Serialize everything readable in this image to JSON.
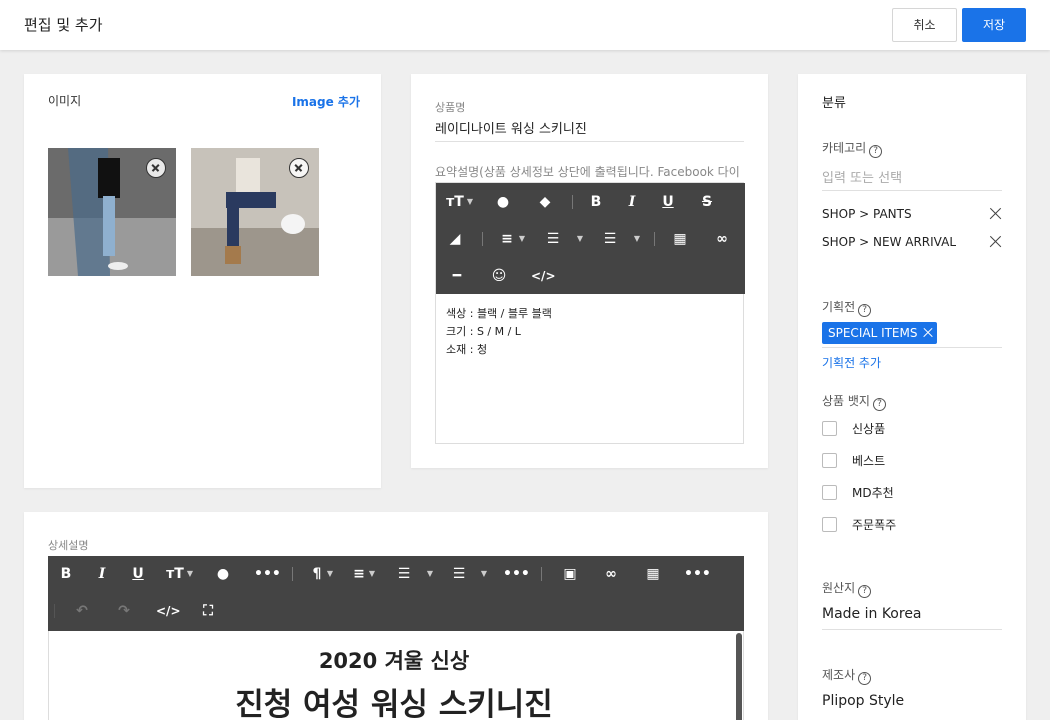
{
  "header": {
    "title": "편집 및 추가",
    "cancel_label": "취소",
    "save_label": "저장"
  },
  "images": {
    "label": "이미지",
    "add_label": "Image 추가"
  },
  "product": {
    "name_label": "상품명",
    "name_value": "레이디나이트 워싱 스키니진",
    "summary_label": "요약설명(상품 상세정보 상단에 출력됩니다. Facebook 다이",
    "summary_lines": [
      "색상 : 블랙 / 블루 블랙",
      "크기 : S / M / L",
      "소재 : 청"
    ]
  },
  "detail": {
    "label": "상세설명",
    "heading_1": "2020 겨울 신상",
    "heading_2": "진청 여성 워싱 스키니진"
  },
  "sidebar": {
    "heading": "분류",
    "category_label": "카테고리",
    "category_placeholder": "입력 또는 선택",
    "categories": [
      "SHOP > PANTS",
      "SHOP > NEW ARRIVAL"
    ],
    "exhibition_label": "기획전",
    "exhibition_tag": "SPECIAL ITEMS",
    "exhibition_add": "기획전 추가",
    "badge_label": "상품 뱃지",
    "badges": [
      "신상품",
      "베스트",
      "MD추천",
      "주문폭주"
    ],
    "origin_label": "원산지",
    "origin_value": "Made in Korea",
    "maker_label": "제조사",
    "maker_value": "Plipop Style"
  },
  "colors": {
    "accent": "#1a73e8",
    "toolbar": "#444444"
  }
}
